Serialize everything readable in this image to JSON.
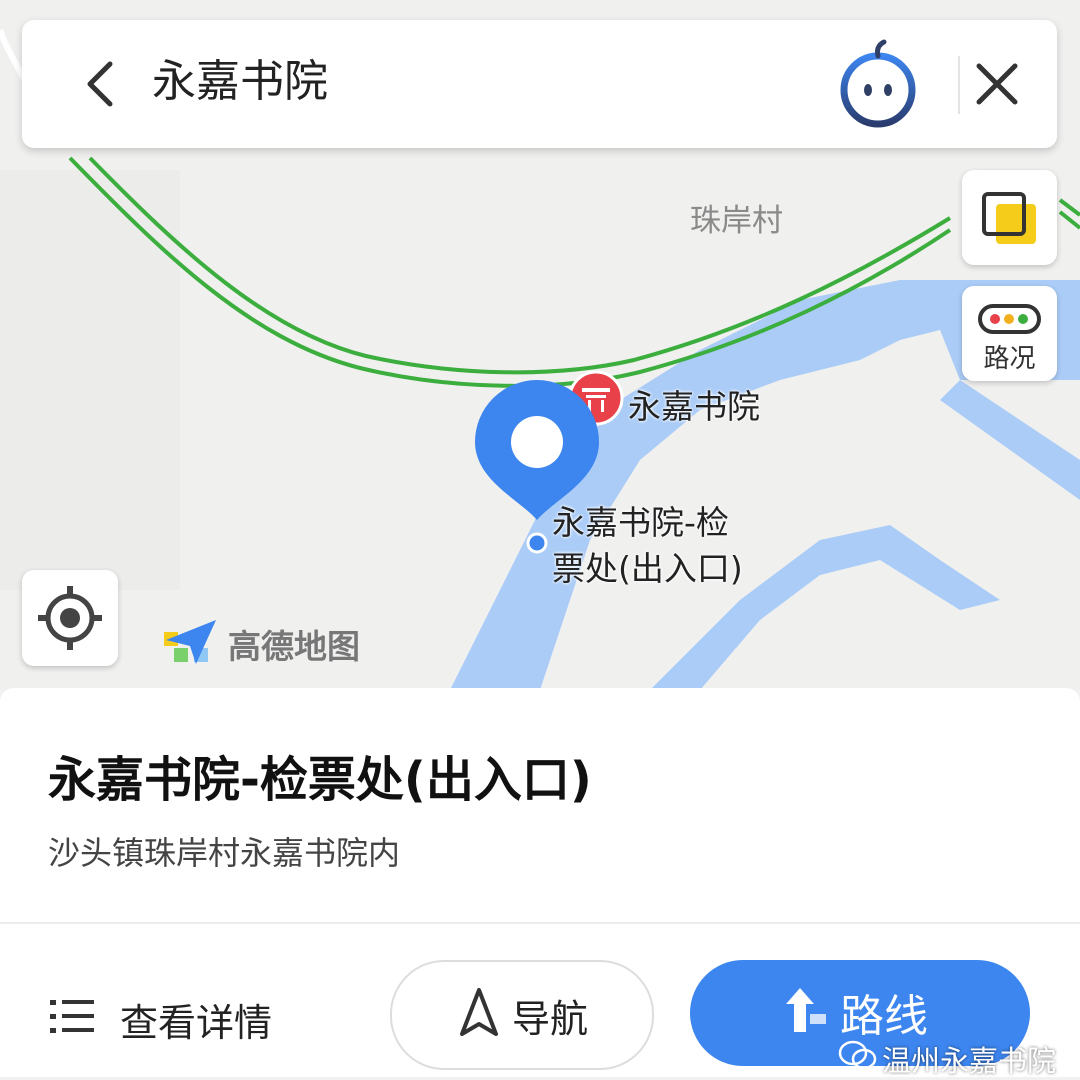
{
  "search": {
    "query": "永嘉书院",
    "back_icon": "chevron-left-icon",
    "assistant_icon": "assistant-avatar-icon",
    "close_icon": "close-icon"
  },
  "map": {
    "village_label": "珠岸村",
    "poi_label": "永嘉书院",
    "ticket_label_line1": "永嘉书院-检",
    "ticket_label_line2": "票处(出入口)",
    "brand": "高德地图",
    "traffic_label": "路况",
    "colors": {
      "road": "#3cae3e",
      "water": "#aaccf7",
      "pin": "#3d85ef",
      "poi": "#e8414a"
    }
  },
  "card": {
    "title": "永嘉书院-检票处(出入口)",
    "address": "沙头镇珠岸村永嘉书院内",
    "details_label": "查看详情",
    "nav_label": "导航",
    "route_label": "路线",
    "accent": "#3d85ef"
  },
  "watermark": {
    "text": "温州永嘉书院"
  }
}
